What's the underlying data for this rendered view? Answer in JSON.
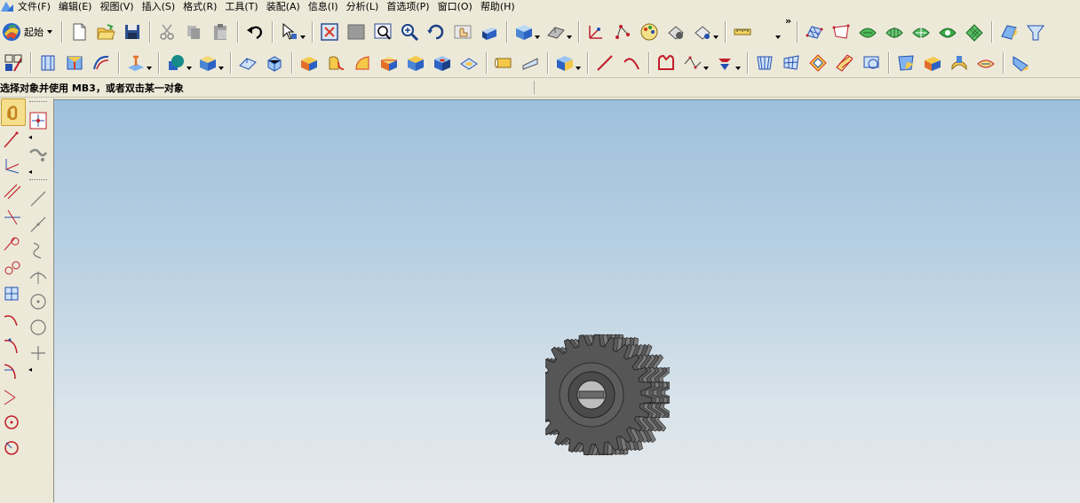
{
  "menubar": {
    "items": [
      "文件(F)",
      "编辑(E)",
      "视图(V)",
      "插入(S)",
      "格式(R)",
      "工具(T)",
      "装配(A)",
      "信息(I)",
      "分析(L)",
      "首选项(P)",
      "窗口(O)",
      "帮助(H)"
    ]
  },
  "toolbar": {
    "start_label": "起始",
    "overflow_label": "»"
  },
  "cue_line": {
    "text": "选择对象并使用 MB3，或者双击某一对象"
  },
  "model": {
    "name": "spur-gear",
    "colors": {
      "body": "#4a4a4a",
      "face": "#6d6d6d",
      "background_top": "#9ec0dc",
      "background_bottom": "#e6e9ec"
    }
  },
  "icons": {
    "toolbar1": [
      "new-file-icon",
      "open-folder-icon",
      "save-icon",
      "cut-icon",
      "copy-icon",
      "paste-icon",
      "undo-icon",
      "select-filter-icon",
      "fit-icon",
      "zoom-window-icon",
      "zoom-icon",
      "rotate-icon",
      "pan-icon",
      "render-style-icon",
      "shaded-box-icon",
      "hidden-edge-icon",
      "point-icon",
      "vertex-icon",
      "palette-icon",
      "wcs-icon",
      "layer-icon",
      "measure-icon",
      "surface-mesh-icon",
      "grid-surface-icon",
      "flat-surface-icon"
    ],
    "toolbar2": [
      "sketch-icon",
      "extrude-icon",
      "revolve-icon",
      "sweep-icon",
      "datum-icon",
      "shell-icon",
      "blend-icon",
      "chamfer-icon",
      "draft-icon",
      "offset-icon",
      "block-icon",
      "cylinder-icon",
      "cone-icon",
      "sphere-icon",
      "boolean-icon",
      "line-icon",
      "arc-icon",
      "curve-icon",
      "spline-icon",
      "fillet-icon"
    ]
  }
}
